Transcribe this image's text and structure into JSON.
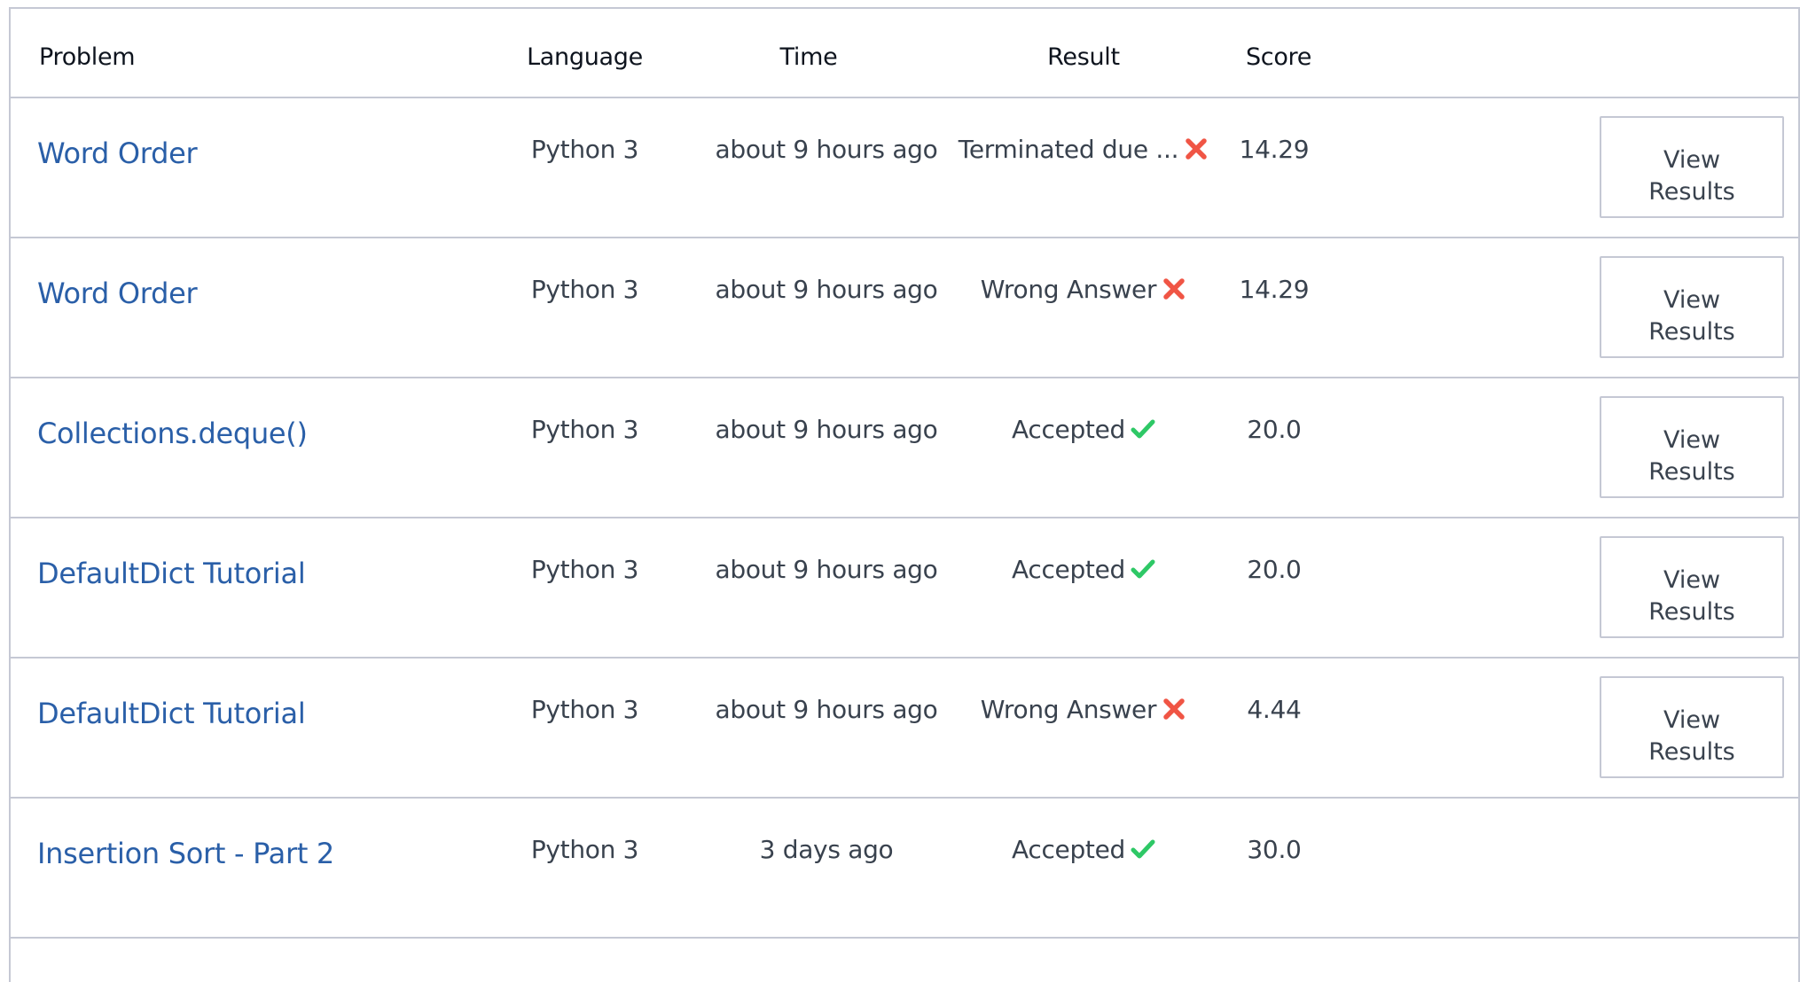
{
  "header": {
    "problem": "Problem",
    "language": "Language",
    "time": "Time",
    "result": "Result",
    "score": "Score"
  },
  "colors": {
    "link": "#2a5fa8",
    "error": "#f05545",
    "success": "#2ec866",
    "border": "#c5c8d4"
  },
  "view_button": {
    "line1": "View",
    "line2": "Results"
  },
  "rows": [
    {
      "problem": "Word Order",
      "language": "Python 3",
      "time": "about 9 hours ago",
      "result": "Terminated due ...",
      "status_icon": "cross-icon",
      "score": "14.29",
      "has_button": true
    },
    {
      "problem": "Word Order",
      "language": "Python 3",
      "time": "about 9 hours ago",
      "result": "Wrong Answer",
      "status_icon": "cross-icon",
      "score": "14.29",
      "has_button": true
    },
    {
      "problem": "Collections.deque()",
      "language": "Python 3",
      "time": "about 9 hours ago",
      "result": "Accepted",
      "status_icon": "check-icon",
      "score": "20.0",
      "has_button": true
    },
    {
      "problem": "DefaultDict Tutorial",
      "language": "Python 3",
      "time": "about 9 hours ago",
      "result": "Accepted",
      "status_icon": "check-icon",
      "score": "20.0",
      "has_button": true
    },
    {
      "problem": "DefaultDict Tutorial",
      "language": "Python 3",
      "time": "about 9 hours ago",
      "result": "Wrong Answer",
      "status_icon": "cross-icon",
      "score": "4.44",
      "has_button": true
    },
    {
      "problem": "Insertion Sort - Part 2",
      "language": "Python 3",
      "time": "3 days ago",
      "result": "Accepted",
      "status_icon": "check-icon",
      "score": "30.0",
      "has_button": false
    }
  ]
}
